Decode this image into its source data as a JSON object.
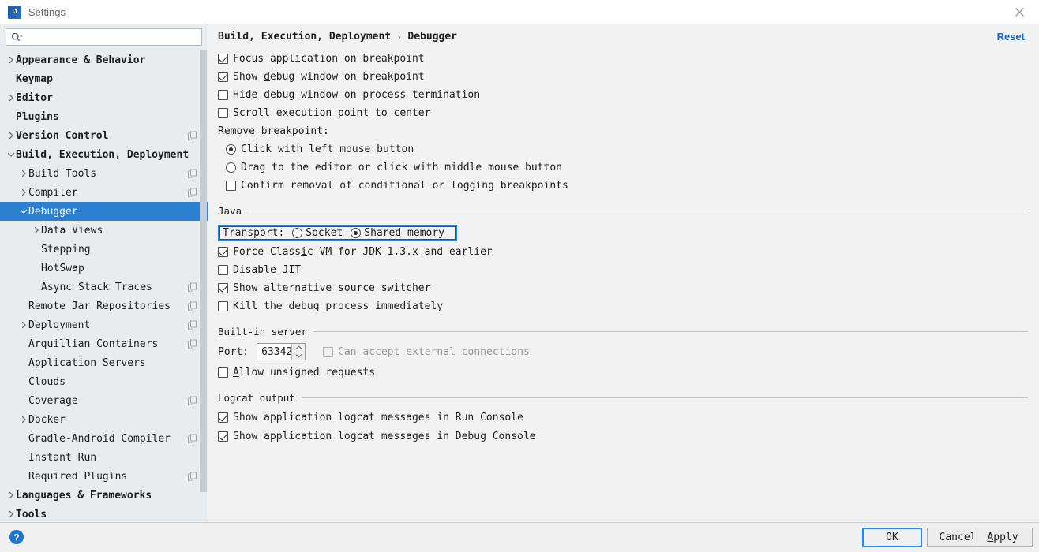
{
  "window": {
    "title": "Settings",
    "logo_icon": "intellij-idea-logo",
    "close_icon": "close-icon"
  },
  "sidebar": {
    "search": {
      "placeholder": "",
      "value": "",
      "icon": "search-icon"
    },
    "items": [
      {
        "label": "Appearance & Behavior",
        "indent": 0,
        "bold": true,
        "arrow": "right",
        "badge": false,
        "selected": false
      },
      {
        "label": "Keymap",
        "indent": 0,
        "bold": true,
        "arrow": "none",
        "badge": false,
        "selected": false
      },
      {
        "label": "Editor",
        "indent": 0,
        "bold": true,
        "arrow": "right",
        "badge": false,
        "selected": false
      },
      {
        "label": "Plugins",
        "indent": 0,
        "bold": true,
        "arrow": "none",
        "badge": false,
        "selected": false
      },
      {
        "label": "Version Control",
        "indent": 0,
        "bold": true,
        "arrow": "right",
        "badge": true,
        "selected": false
      },
      {
        "label": "Build, Execution, Deployment",
        "indent": 0,
        "bold": true,
        "arrow": "down",
        "badge": false,
        "selected": false
      },
      {
        "label": "Build Tools",
        "indent": 1,
        "bold": false,
        "arrow": "right",
        "badge": true,
        "selected": false
      },
      {
        "label": "Compiler",
        "indent": 1,
        "bold": false,
        "arrow": "right",
        "badge": true,
        "selected": false
      },
      {
        "label": "Debugger",
        "indent": 1,
        "bold": false,
        "arrow": "down",
        "badge": false,
        "selected": true
      },
      {
        "label": "Data Views",
        "indent": 2,
        "bold": false,
        "arrow": "right",
        "badge": false,
        "selected": false
      },
      {
        "label": "Stepping",
        "indent": 2,
        "bold": false,
        "arrow": "none",
        "badge": false,
        "selected": false
      },
      {
        "label": "HotSwap",
        "indent": 2,
        "bold": false,
        "arrow": "none",
        "badge": false,
        "selected": false
      },
      {
        "label": "Async Stack Traces",
        "indent": 2,
        "bold": false,
        "arrow": "none",
        "badge": true,
        "selected": false
      },
      {
        "label": "Remote Jar Repositories",
        "indent": 1,
        "bold": false,
        "arrow": "none",
        "badge": true,
        "selected": false
      },
      {
        "label": "Deployment",
        "indent": 1,
        "bold": false,
        "arrow": "right",
        "badge": true,
        "selected": false
      },
      {
        "label": "Arquillian Containers",
        "indent": 1,
        "bold": false,
        "arrow": "none",
        "badge": true,
        "selected": false
      },
      {
        "label": "Application Servers",
        "indent": 1,
        "bold": false,
        "arrow": "none",
        "badge": false,
        "selected": false
      },
      {
        "label": "Clouds",
        "indent": 1,
        "bold": false,
        "arrow": "none",
        "badge": false,
        "selected": false
      },
      {
        "label": "Coverage",
        "indent": 1,
        "bold": false,
        "arrow": "none",
        "badge": true,
        "selected": false
      },
      {
        "label": "Docker",
        "indent": 1,
        "bold": false,
        "arrow": "right",
        "badge": false,
        "selected": false
      },
      {
        "label": "Gradle-Android Compiler",
        "indent": 1,
        "bold": false,
        "arrow": "none",
        "badge": true,
        "selected": false
      },
      {
        "label": "Instant Run",
        "indent": 1,
        "bold": false,
        "arrow": "none",
        "badge": false,
        "selected": false
      },
      {
        "label": "Required Plugins",
        "indent": 1,
        "bold": false,
        "arrow": "none",
        "badge": true,
        "selected": false
      },
      {
        "label": "Languages & Frameworks",
        "indent": 0,
        "bold": true,
        "arrow": "right",
        "badge": false,
        "selected": false
      },
      {
        "label": "Tools",
        "indent": 0,
        "bold": true,
        "arrow": "right",
        "badge": false,
        "selected": false
      }
    ]
  },
  "main": {
    "breadcrumb": {
      "root": "Build, Execution, Deployment",
      "separator": "›",
      "leaf": "Debugger"
    },
    "reset_label": "Reset",
    "general": [
      {
        "label": "Focus application on breakpoint",
        "checked": true,
        "mnemonic": ""
      },
      {
        "label": "Show debug window on breakpoint",
        "checked": true,
        "mnemonic": "d"
      },
      {
        "label": "Hide debug window on process termination",
        "checked": false,
        "mnemonic": "w"
      },
      {
        "label": "Scroll execution point to center",
        "checked": false,
        "mnemonic": ""
      }
    ],
    "remove_breakpoint": {
      "label": "Remove breakpoint:",
      "options": [
        {
          "label": "Click with left mouse button",
          "selected": true
        },
        {
          "label": "Drag to the editor or click with middle mouse button",
          "selected": false
        }
      ],
      "confirm": {
        "label": "Confirm removal of conditional or logging breakpoints",
        "checked": false
      }
    },
    "java": {
      "group_title": "Java",
      "transport": {
        "label": "Transport:",
        "highlighted": true,
        "highlight_color": "#1a8cff",
        "options": [
          {
            "label": "Socket",
            "selected": false,
            "mnemonic": "S"
          },
          {
            "label": "Shared memory",
            "selected": true,
            "mnemonic": "m"
          }
        ]
      },
      "checkboxes": [
        {
          "label": "Force Classic VM for JDK 1.3.x and earlier",
          "checked": true,
          "mnemonic": "i"
        },
        {
          "label": "Disable JIT",
          "checked": false,
          "mnemonic": ""
        },
        {
          "label": "Show alternative source switcher",
          "checked": true,
          "mnemonic": ""
        },
        {
          "label": "Kill the debug process immediately",
          "checked": false,
          "mnemonic": ""
        }
      ]
    },
    "builtin_server": {
      "group_title": "Built-in server",
      "port_label": "Port:",
      "port_value": "63342",
      "external": {
        "label": "Can accept external connections",
        "checked": false,
        "disabled": true,
        "mnemonic": "e"
      },
      "unsigned": {
        "label": "Allow unsigned requests",
        "checked": false,
        "disabled": false,
        "mnemonic": "A"
      }
    },
    "logcat": {
      "group_title": "Logcat output",
      "checkboxes": [
        {
          "label": "Show application logcat messages in Run Console",
          "checked": true
        },
        {
          "label": "Show application logcat messages in Debug Console",
          "checked": true
        }
      ]
    }
  },
  "footer": {
    "help_icon": "help-question-icon",
    "ok_label": "OK",
    "cancel_label": "Cancel",
    "apply_label": "Apply",
    "apply_mnemonic": "A",
    "default_button": "OK"
  }
}
